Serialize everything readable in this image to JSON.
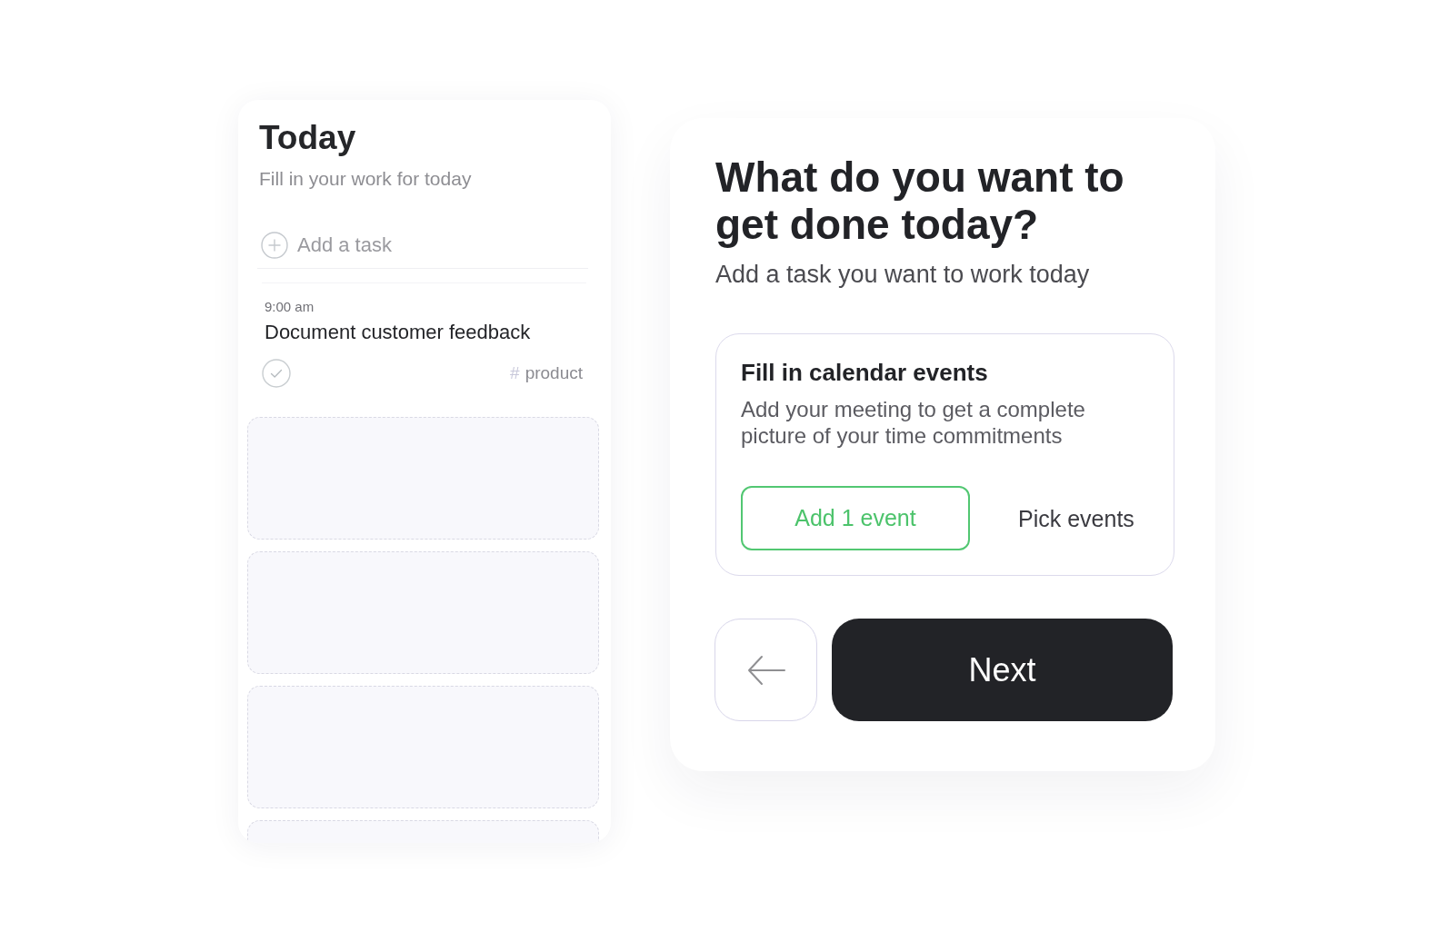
{
  "today_panel": {
    "title": "Today",
    "subtitle": "Fill in your work for today",
    "add_task_field": {
      "placeholder": "Add a task"
    },
    "tasks": [
      {
        "time": "9:00 am",
        "title": "Document customer feedback",
        "done": false,
        "tag_prefix": "#",
        "tag": "product"
      }
    ]
  },
  "setup_card": {
    "title": "What do you want to get done today?",
    "subtitle": "Add a task you want to work today",
    "calendar_card": {
      "title": "Fill in calendar events",
      "description": "Add your meeting to get a complete picture of your time commitments",
      "actions": [
        {
          "label": "Add 1 event",
          "kind": "outline"
        },
        {
          "label": "Pick events",
          "kind": "text"
        }
      ]
    },
    "navigation": [
      {
        "kind": "back"
      },
      {
        "kind": "primary",
        "label": "Next"
      }
    ]
  }
}
